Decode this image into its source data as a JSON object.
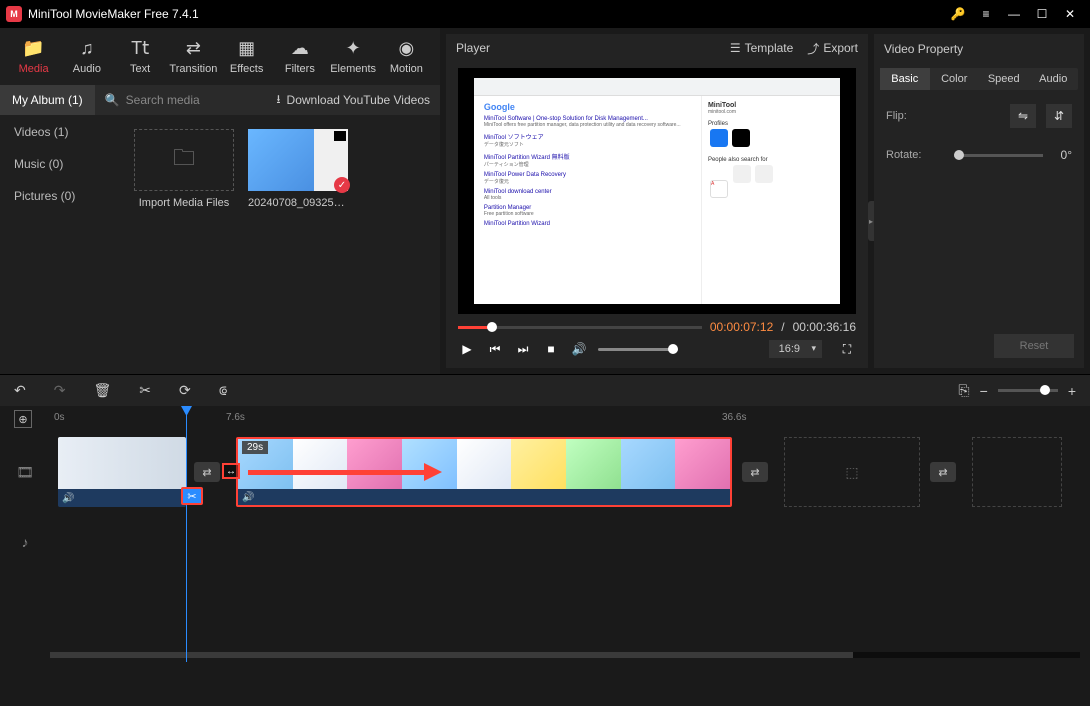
{
  "app": {
    "title": "MiniTool MovieMaker Free 7.4.1"
  },
  "toolTabs": {
    "media": {
      "label": "Media",
      "icon": "📁"
    },
    "audio": {
      "label": "Audio",
      "icon": "♫"
    },
    "text": {
      "label": "Text",
      "icon": "T𝗍"
    },
    "transition": {
      "label": "Transition",
      "icon": "⇄"
    },
    "effects": {
      "label": "Effects",
      "icon": "▦"
    },
    "filters": {
      "label": "Filters",
      "icon": "☁"
    },
    "elements": {
      "label": "Elements",
      "icon": "✦"
    },
    "motion": {
      "label": "Motion",
      "icon": "◉"
    }
  },
  "mediaHeader": {
    "albumLabel": "My Album (1)",
    "searchPlaceholder": "Search media",
    "downloadYT": "Download YouTube Videos"
  },
  "mediaNav": {
    "videos": "Videos (1)",
    "music": "Music (0)",
    "pictures": "Pictures (0)"
  },
  "mediaGrid": {
    "importLabel": "Import Media Files",
    "clip1Name": "20240708_093259..."
  },
  "player": {
    "title": "Player",
    "templateLabel": "Template",
    "exportLabel": "Export",
    "currentTime": "00:00:07:12",
    "timeSeparator": " / ",
    "totalTime": "00:00:36:16",
    "aspect": "16:9"
  },
  "videoProperty": {
    "title": "Video Property",
    "tabs": {
      "basic": "Basic",
      "color": "Color",
      "speed": "Speed",
      "audio": "Audio"
    },
    "flipLabel": "Flip:",
    "rotateLabel": "Rotate:",
    "rotateValue": "0°",
    "resetLabel": "Reset"
  },
  "ruler": {
    "t0": "0s",
    "t1": "7.6s",
    "t2": "36.6s"
  },
  "timeline": {
    "clip2Duration": "29s"
  }
}
